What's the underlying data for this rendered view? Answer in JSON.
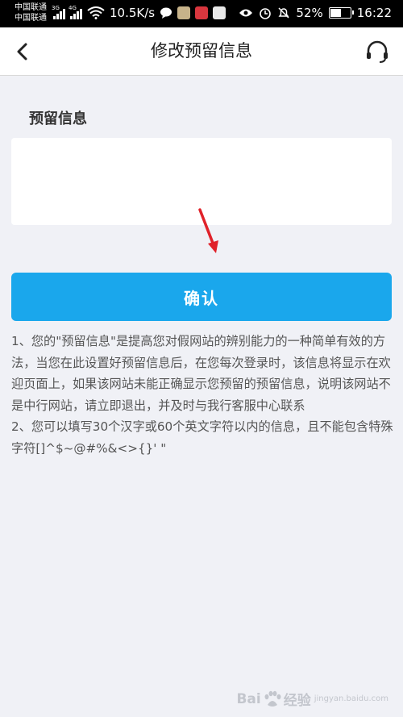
{
  "status_bar": {
    "carrier_1": "中国联通",
    "carrier_2": "中国联通",
    "net_1": "3G",
    "net_2": "4G",
    "speed": "10.5K/s",
    "battery": "52%",
    "battery_level": 0.52,
    "time": "16:22"
  },
  "navbar": {
    "title": "修改预留信息"
  },
  "form": {
    "label": "预留信息",
    "value": "",
    "placeholder": "",
    "confirm_label": "确认"
  },
  "notes": [
    "1、您的\"预留信息\"是提高您对假网站的辨别能力的一种简单有效的方法，当您在此设置好预留信息后，在您每次登录时，该信息将显示在欢迎页面上，如果该网站未能正确显示您预留的预留信息，说明该网站不是中行网站，请立即退出，并及时与我行客服中心联系",
    "2、您可以填写30个汉字或60个英文字符以内的信息，且不能包含特殊字符[]^$~@#%&<>{}' \""
  ],
  "watermark": {
    "brand": "Bai",
    "brand2": "经验",
    "sub": "jingyan.baidu.com"
  },
  "colors": {
    "accent": "#1aa7ec",
    "background": "#f0f1f6",
    "annotation_arrow": "#e0222a"
  },
  "icons": {
    "back": "chevron-left-icon",
    "support": "headset-icon"
  }
}
